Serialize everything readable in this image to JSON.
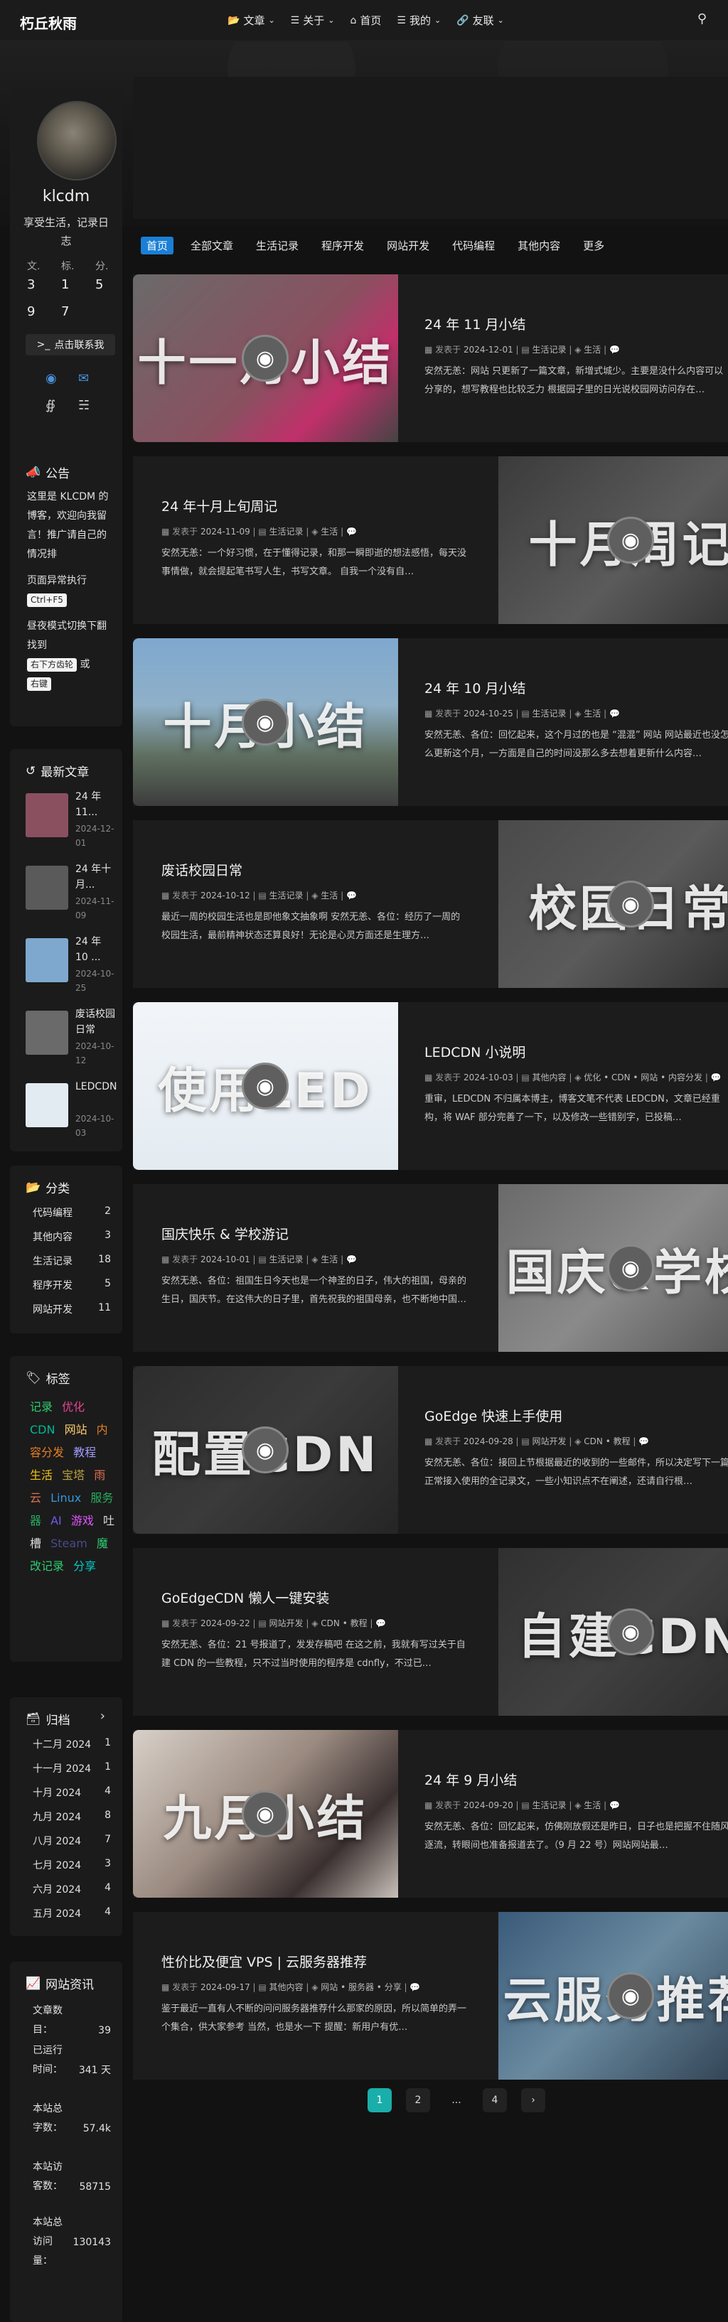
{
  "nav": {
    "brand": "朽丘秋雨",
    "menu": [
      {
        "icon": "folder-open-icon",
        "glyph": "📂",
        "label": "文章",
        "caret": true
      },
      {
        "icon": "list-icon",
        "glyph": "☰",
        "label": "关于",
        "caret": true
      },
      {
        "icon": "home-icon",
        "glyph": "⌂",
        "label": "首页",
        "caret": false
      },
      {
        "icon": "list-icon",
        "glyph": "☰",
        "label": "我的",
        "caret": true
      },
      {
        "icon": "link-icon",
        "glyph": "🔗",
        "label": "友联",
        "caret": true
      }
    ],
    "search_icon": "search-icon"
  },
  "tabs": [
    "首页",
    "全部文章",
    "生活记录",
    "程序开发",
    "网站开发",
    "代码编程",
    "其他内容",
    "更多"
  ],
  "profile": {
    "name": "klcdm",
    "motto": "享受生活，记录日志",
    "stat_labels": [
      "文.",
      "标.",
      "分."
    ],
    "stat_values_row1": [
      "3",
      "1",
      "5"
    ],
    "stat_values_row2": [
      "9",
      "7"
    ],
    "contact_label": "点击联系我"
  },
  "notice": {
    "title": "公告",
    "text": "这里是 KLCDM 的博客，欢迎向我留言！推广请自己的情况排",
    "line2": "页面异常执行",
    "kbd1": "Ctrl+F5",
    "line3": "昼夜模式切换下翻找到",
    "kbd2": "右下方齿轮",
    "or": "或",
    "kbd3": "右键"
  },
  "recent": {
    "title": "最新文章",
    "items": [
      {
        "title": "24 年 11...",
        "date": "2024-12-01"
      },
      {
        "title": "24 年十月...",
        "date": "2024-11-09"
      },
      {
        "title": "24 年 10 ...",
        "date": "2024-10-25"
      },
      {
        "title": "废话校园日常",
        "date": "2024-10-12"
      },
      {
        "title": "LEDCDN...",
        "date": "2024-10-03"
      }
    ]
  },
  "categories": {
    "title": "分类",
    "items": [
      {
        "name": "代码编程",
        "count": "2"
      },
      {
        "name": "其他内容",
        "count": "3"
      },
      {
        "name": "生活记录",
        "count": "18"
      },
      {
        "name": "程序开发",
        "count": "5"
      },
      {
        "name": "网站开发",
        "count": "11"
      }
    ]
  },
  "tags": {
    "title": "标签",
    "items": [
      {
        "text": "记录",
        "color": "#2ecc71"
      },
      {
        "text": "优化",
        "color": "#e84393"
      },
      {
        "text": "CDN",
        "color": "#00b894"
      },
      {
        "text": "网站",
        "color": "#fdcb6e"
      },
      {
        "text": "内容分发",
        "color": "#e67e22"
      },
      {
        "text": "教程",
        "color": "#a29bfe"
      },
      {
        "text": "生活",
        "color": "#f1c40f"
      },
      {
        "text": "宝塔",
        "color": "#b8a040"
      },
      {
        "text": "雨云",
        "color": "#e17055"
      },
      {
        "text": "Linux",
        "color": "#3498db"
      },
      {
        "text": "服务器",
        "color": "#27ae60"
      },
      {
        "text": "AI",
        "color": "#6c5ce7"
      },
      {
        "text": "游戏",
        "color": "#e056fd"
      },
      {
        "text": "吐槽",
        "color": "#dcdcdc"
      },
      {
        "text": "Steam",
        "color": "#4a4a8a"
      },
      {
        "text": "魔改记录",
        "color": "#2ecc71"
      },
      {
        "text": "分享",
        "color": "#00cec9"
      }
    ]
  },
  "archive": {
    "title": "归档",
    "items": [
      {
        "month": "十二月 2024",
        "count": "1"
      },
      {
        "month": "十一月 2024",
        "count": "1"
      },
      {
        "month": "十月 2024",
        "count": "4"
      },
      {
        "month": "九月 2024",
        "count": "8"
      },
      {
        "month": "八月 2024",
        "count": "7"
      },
      {
        "month": "七月 2024",
        "count": "3"
      },
      {
        "month": "六月 2024",
        "count": "4"
      },
      {
        "month": "五月 2024",
        "count": "4"
      }
    ]
  },
  "siteinfo": {
    "title": "网站资讯",
    "rows": [
      {
        "label": "文章数目：",
        "value": "39"
      },
      {
        "label": "已运行时间：",
        "value": "341 天"
      },
      {
        "label": "本站总字数：",
        "value": "57.4k"
      },
      {
        "label": "本站访客数：",
        "value": "58715"
      },
      {
        "label": "本站总访问量：",
        "value": "130143"
      }
    ]
  },
  "posts": [
    {
      "title": "24 年 11 月小结",
      "date": "2024-12-01",
      "cat": "生活记录",
      "tag": "生活",
      "img_text": "十一月小结",
      "desc": "安然无恙：网站 只更新了一篇文章，新增式城少。主要是没什么内容可以分享的，想写教程也比较乏力 根据园子里的日光说校园网访问存在…",
      "bg": "linear-gradient(135deg,#6a6a6a,#8a5060 55%,#c0306a 75%,#444)"
    },
    {
      "title": "24 年十月上旬周记",
      "date": "2024-11-09",
      "cat": "生活记录",
      "tag": "生活",
      "img_text": "十月周记",
      "desc": "安然无恙：一个好习惯，在于懂得记录，和那一瞬即逝的想法感悟，每天没事情做，就会提起笔书写人生，书写文章。 自我一个没有自…",
      "bg": "linear-gradient(135deg,#3b3b3b,#5b5b5b 55%,#2f2f2f)"
    },
    {
      "title": "24 年 10 月小结",
      "date": "2024-10-25",
      "cat": "生活记录",
      "tag": "生活",
      "img_text": "十月小结",
      "desc": "安然无恙、各位：回忆起来，这个月过的也是 “混混” 网站 网站最近也没怎么更新这个月，一方面是自己的时间没那么多去想着更新什么内容…",
      "bg": "linear-gradient(180deg,#7fa8cf 0%,#8fb0c8 40%,#5f6f5f 70%,#3c3c3c)"
    },
    {
      "title": "废话校园日常",
      "date": "2024-10-12",
      "cat": "生活记录",
      "tag": "生活",
      "img_text": "校园日常",
      "desc": "最近一周的校园生活也是即他象文抽象啊 安然无恙、各位：经历了一周的校园生活，最前精神状态还算良好！无论是心灵方面还是生理方…",
      "bg": "linear-gradient(135deg,#4a4a4a,#5a5a5a 50%,#2a2a2a)"
    },
    {
      "title": "LEDCDN 小说明",
      "date": "2024-10-03",
      "cat": "其他内容",
      "tag": "优化 • CDN • 网站 • 内容分发",
      "img_text": "使用LED",
      "desc": "重审，LEDCDN 不归属本博主，博客文笔不代表 LEDCDN，文章已经重构，将 WAF 部分完善了一下，以及修改一些错别字，已投稿…",
      "bg": "linear-gradient(180deg,#f2f5f8,#e3ebf2)"
    },
    {
      "title": "国庆快乐 & 学校游记",
      "date": "2024-10-01",
      "cat": "生活记录",
      "tag": "生活",
      "img_text": "国庆&学校",
      "desc": "安然无恙、各位：祖国生日今天也是一个神圣的日子，伟大的祖国，母亲的生日，国庆节。在这伟大的日子里，首先祝我的祖国母亲，也不断地中国…",
      "bg": "linear-gradient(135deg,#6a6a6a,#8a8a8a 50%,#505050)"
    },
    {
      "title": "GoEdge 快速上手使用",
      "date": "2024-09-28",
      "cat": "网站开发",
      "tag": "CDN • 教程",
      "img_text": "配置CDN",
      "desc": "安然无恙、各位：接回上节根据最近的收到的一些邮件，所以决定写下一篇正常接入使用的全记录文，一些小知识点不在阐述，还请自行根…",
      "bg": "linear-gradient(135deg,#2c2c2c,#3a3a3a 50%,#252525)"
    },
    {
      "title": "GoEdgeCDN 懒人一键安装",
      "date": "2024-09-22",
      "cat": "网站开发",
      "tag": "CDN • 教程",
      "img_text": "自建CDN",
      "desc": "安然无恙、各位：21 号报道了，发发存稿吧 在这之前，我就有写过关于自建 CDN 的一些教程，只不过当时使用的程序是 cdnfly，不过已…",
      "bg": "linear-gradient(135deg,#303030,#404040 50%,#2a2a2a)"
    },
    {
      "title": "24 年 9 月小结",
      "date": "2024-09-20",
      "cat": "生活记录",
      "tag": "生活",
      "img_text": "九月小结",
      "desc": "安然无恙、各位：回忆起来，仿佛刚放假还是昨日，日子也是把握不住随风逐流，转眼间也准备报道去了。（9 月 22 号）网站网站最…",
      "bg": "linear-gradient(135deg,#d8d0c8,#9a8a80 45%,#3a3030 75%,#c8c0b8)"
    },
    {
      "title": "性价比及便宜 VPS | 云服务器推荐",
      "date": "2024-09-17",
      "cat": "其他内容",
      "tag": "网站 • 服务器 • 分享",
      "img_text": "云服务推荐",
      "desc": "鉴于最近一直有人不断的问问服务器推荐什么那家的原因，所以简单的弄一个集合，供大家参考 当然，也是水一下 提醒：新用户有优…",
      "bg": "linear-gradient(135deg,#3a5a7a,#6a8aa0 45%,#2a3a4a)"
    }
  ],
  "pagination": [
    "1",
    "2",
    "...",
    "4",
    "›"
  ]
}
